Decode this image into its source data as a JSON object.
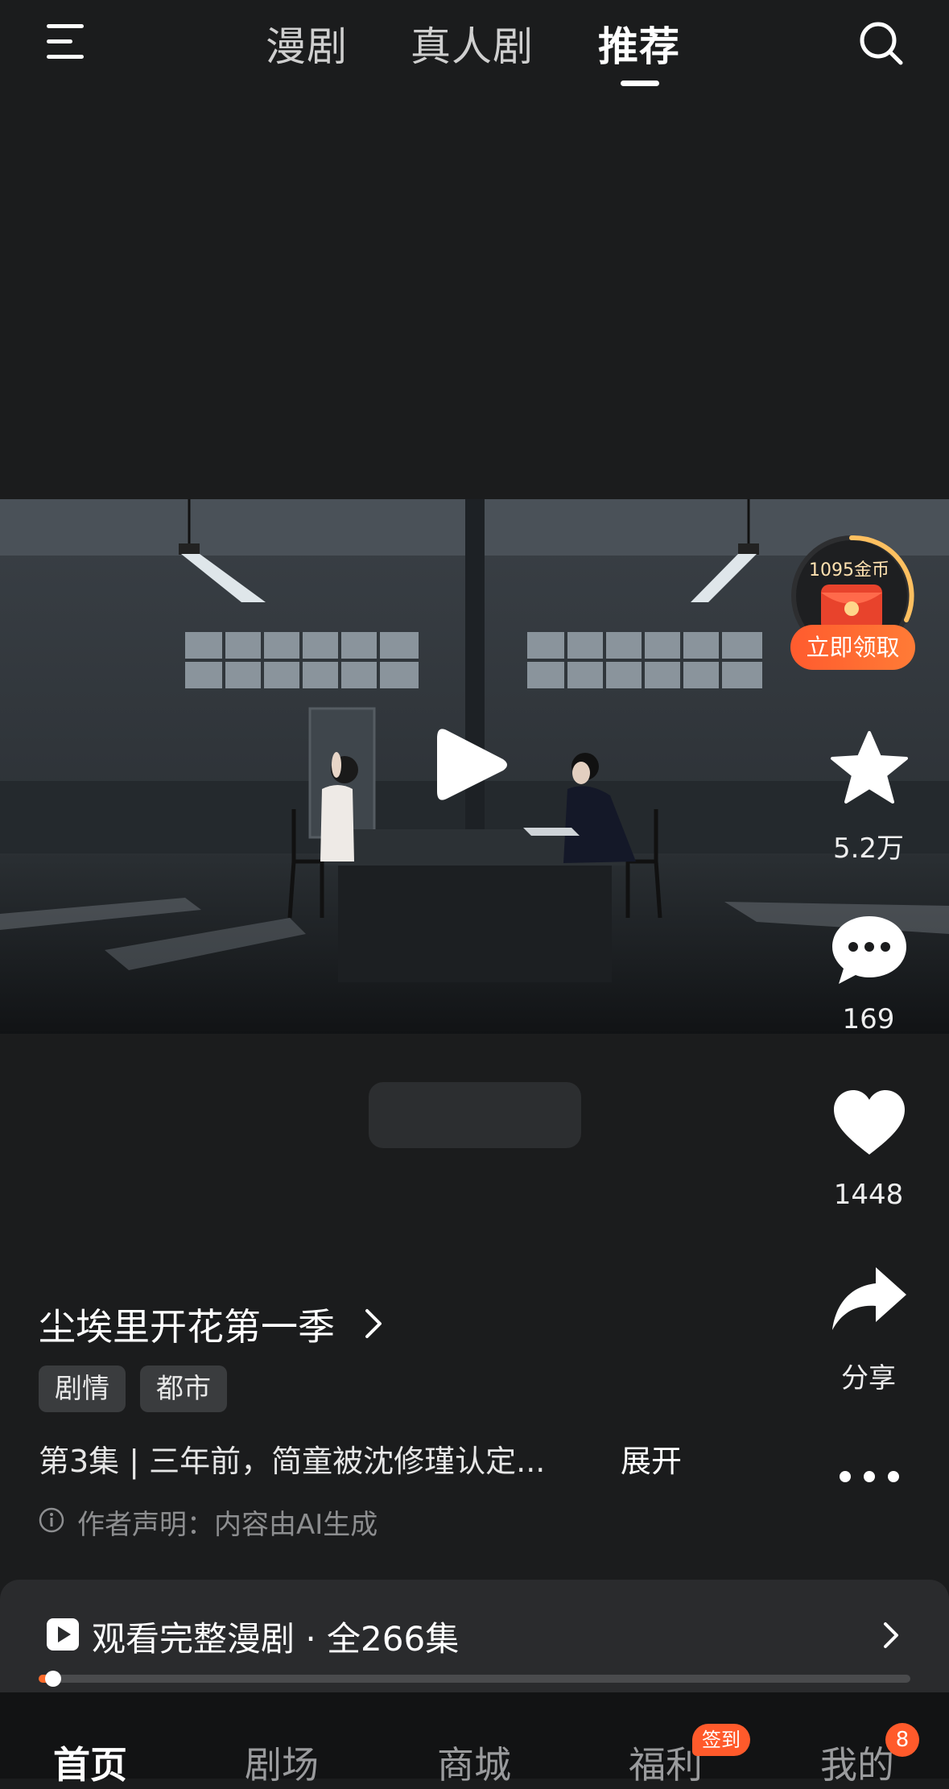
{
  "header": {
    "tabs": [
      {
        "label": "漫剧",
        "active": false
      },
      {
        "label": "真人剧",
        "active": false
      },
      {
        "label": "推荐",
        "active": true
      }
    ]
  },
  "reward": {
    "coins_label": "1095金币",
    "button_label": "立即领取"
  },
  "actions": {
    "favorite_count": "5.2万",
    "comment_count": "169",
    "like_count": "1448",
    "share_label": "分享"
  },
  "drama": {
    "title": "尘埃里开花第一季",
    "tags": [
      "剧情",
      "都市"
    ],
    "description": "第3集 | 三年前，简童被沈修瑾认定...",
    "expand_label": "展开",
    "notice": "作者声明：内容由AI生成"
  },
  "panel": {
    "label": "观看完整漫剧 · 全266集",
    "progress": 0.01
  },
  "nav": {
    "items": [
      {
        "label": "首页",
        "active": true
      },
      {
        "label": "剧场",
        "active": false
      },
      {
        "label": "商城",
        "active": false
      },
      {
        "label": "福利",
        "active": false,
        "badge": "签到"
      },
      {
        "label": "我的",
        "active": false,
        "badge": "8"
      }
    ]
  },
  "colors": {
    "accent": "#ff6a2a",
    "background": "#1b1c1d"
  },
  "icons": [
    "menu-icon",
    "search-icon",
    "play-icon",
    "star-icon",
    "comment-icon",
    "heart-icon",
    "share-icon",
    "more-icon",
    "info-icon",
    "chevron-right-icon",
    "red-envelope-icon"
  ]
}
